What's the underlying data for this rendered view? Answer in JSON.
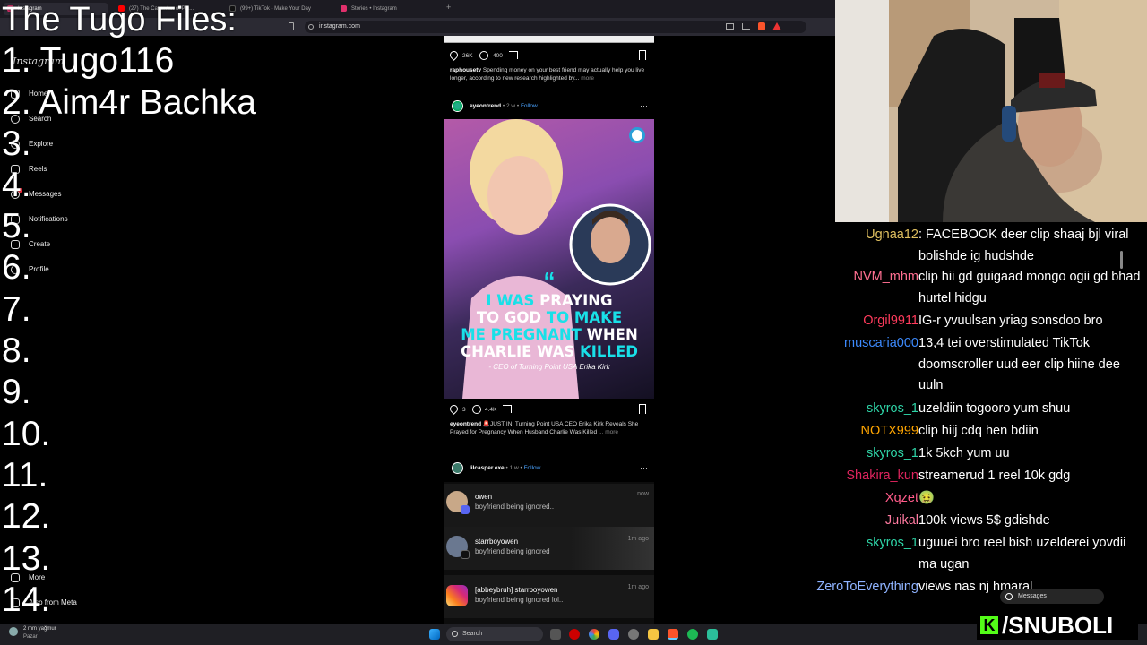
{
  "overlay": {
    "title": "The Tugo Files:",
    "list": [
      "1. Tugo116",
      "2. Aim4r Bachka",
      "3.",
      "4.",
      "5.",
      "6.",
      "7.",
      "8.",
      "9.",
      "10.",
      "11.",
      "12.",
      "13.",
      "14."
    ]
  },
  "browser": {
    "tabs": [
      {
        "label": "Instagram",
        "color": "#e1306c"
      },
      {
        "label": "(27) The Cave: A... of Pla...",
        "color": "#ff0000"
      },
      {
        "label": "(99+) TikTok - Make Your Day",
        "color": "#111111"
      },
      {
        "label": "Stories • Instagram",
        "color": "#e1306c"
      }
    ],
    "new_tab": "+",
    "url": "instagram.com"
  },
  "instagram": {
    "logo": "Instagram",
    "nav": [
      {
        "label": "Home",
        "icon": "home-icon"
      },
      {
        "label": "Search",
        "icon": "search-icon"
      },
      {
        "label": "Explore",
        "icon": "compass-icon"
      },
      {
        "label": "Reels",
        "icon": "reels-icon"
      },
      {
        "label": "Messages",
        "icon": "messenger-icon"
      },
      {
        "label": "Notifications",
        "icon": "heart-icon"
      },
      {
        "label": "Create",
        "icon": "plus-icon"
      },
      {
        "label": "Profile",
        "icon": "avatar-icon"
      }
    ],
    "more": "More",
    "also_from_meta": "Also from Meta",
    "post1": {
      "likes": "26K",
      "comments": "400",
      "username": "raphousetv",
      "caption": "Spending money on your best friend may actually help you live longer, according to new research highlighted by...",
      "more": "more"
    },
    "post2": {
      "username": "eyeontrend",
      "age": "• 2 w •",
      "follow": "Follow",
      "quote_mark": "“",
      "headline_1a": "I WAS",
      "headline_1b": "PRAYING",
      "headline_2a": "TO GOD",
      "headline_2b": "TO MAKE",
      "headline_3a": "ME PREGNANT",
      "headline_3b": "WHEN",
      "headline_4a": "CHARLIE WAS",
      "headline_4b": "KILLED",
      "attribution": "- CEO of Turning Point USA Erika Kirk",
      "likes": "3",
      "comments": "4.4K",
      "caption": "🚨JUST IN: Turning Point USA CEO Erika Kirk Reveals She Prayed for Pregnancy When Husband Charlie Was Killed",
      "more": "... more"
    },
    "post3": {
      "username": "lilcasper.exe",
      "age": "• 1 w •",
      "follow": "Follow",
      "notifications": [
        {
          "name": "owen",
          "message": "boyfriend being ignored..",
          "time": "now"
        },
        {
          "name": "starrboyowen",
          "message": "boyfriend being ignored",
          "time": "1m ago"
        },
        {
          "name": "[abbeybruh] starrboyowen",
          "message": "boyfriend being ignored lol..",
          "time": "1m ago"
        }
      ]
    },
    "messages_pill": "Messages"
  },
  "taskbar": {
    "weather_line1": "2 mm yağmur",
    "weather_line2": "Pazar",
    "search": "Search"
  },
  "chat": [
    {
      "user": "Ugnaa12",
      "color": "#e0c060",
      "message": ": FACEBOOK deer clip shaaj bjl viral bolishde ig hudshde"
    },
    {
      "user": "NVM_mhm",
      "color": "#ff6f91",
      "message": "clip hii gd guigaad mongo ogii gd bhad hurtel hidgu"
    },
    {
      "user": "Orgil9911",
      "color": "#ff3b5c",
      "message": "IG-r yvuulsan yriag sonsdoo bro"
    },
    {
      "user": "muscaria000",
      "color": "#3d8bff",
      "message": "13,4 tei overstimulated TikTok doomscroller uud eer clip hiine dee uuln"
    },
    {
      "user": "skyros_1",
      "color": "#2ed3a6",
      "message": "uzeldiin togooro yum shuu"
    },
    {
      "user": "NOTX999",
      "color": "#ffa500",
      "message": "clip hiij cdq hen bdiin"
    },
    {
      "user": "skyros_1",
      "color": "#2ed3a6",
      "message": "1k 5kch yum uu"
    },
    {
      "user": "Shakira_kun",
      "color": "#e0245e",
      "message": "streamerud 1 reel 10k gdg"
    },
    {
      "user": "Xqzet",
      "color": "#ff5c8a",
      "message": "🤢"
    },
    {
      "user": "Juikal",
      "color": "#ff7aa0",
      "message": "100k views 5$ gdishde"
    },
    {
      "user": "skyros_1",
      "color": "#2ed3a6",
      "message": "uguuei bro reel bish uzelderei yovdii ma ugan"
    },
    {
      "user": "ZeroToEverything",
      "color": "#8fb3ff",
      "message": "views nas nj hmaral"
    }
  ],
  "brand": {
    "logo": "K",
    "handle": "/SNUBOLI",
    "accent": "#53fc18"
  }
}
